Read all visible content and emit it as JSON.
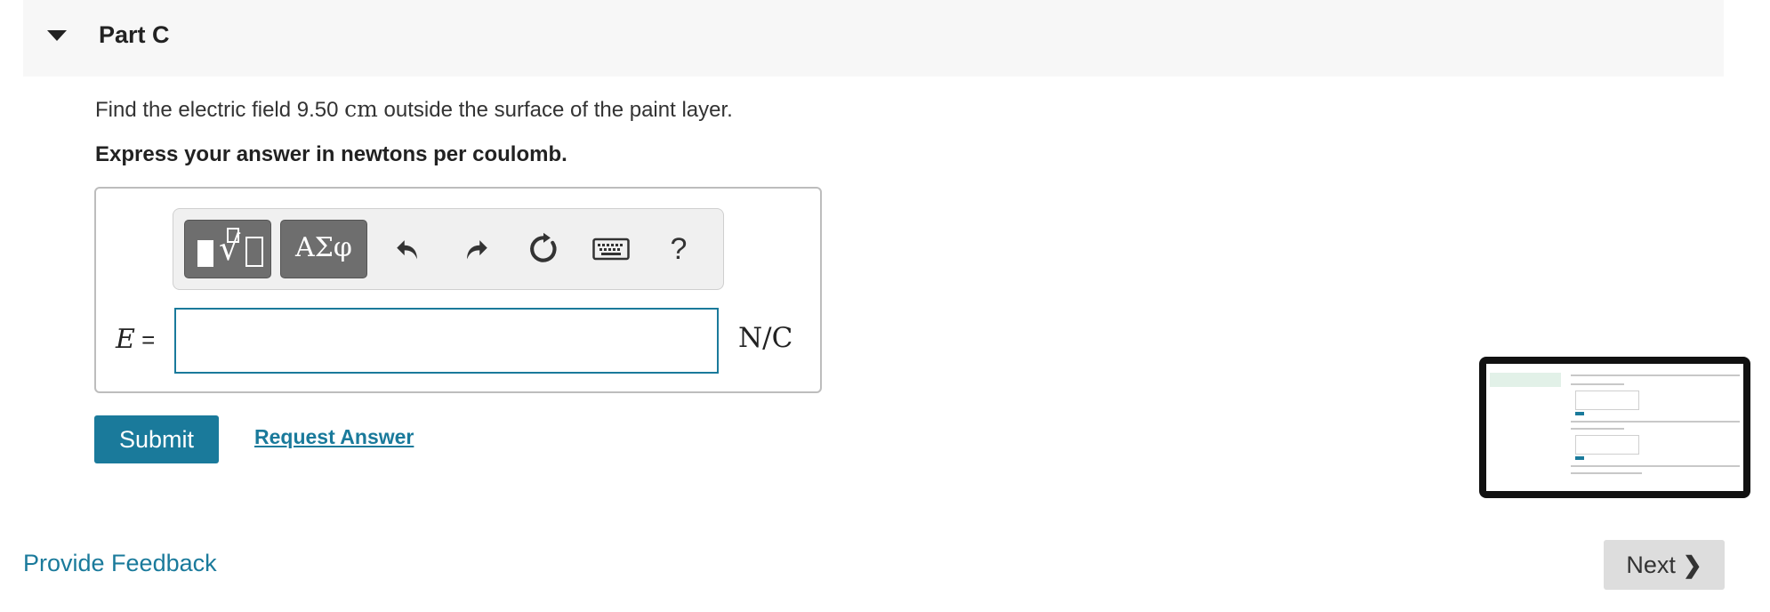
{
  "part": {
    "title": "Part C"
  },
  "question": {
    "text_before": "Find the electric field ",
    "value": "9.50",
    "unit": "cm",
    "text_after": " outside the surface of the paint layer."
  },
  "instruction": "Express your answer in newtons per coulomb.",
  "toolbar": {
    "greek_label": "ΑΣφ",
    "help_label": "?"
  },
  "answer": {
    "variable": "E",
    "equals": " =",
    "input_value": "",
    "unit": "N/C"
  },
  "actions": {
    "submit_label": "Submit",
    "request_answer_label": "Request Answer"
  },
  "footer": {
    "feedback_label": "Provide Feedback",
    "next_label": "Next"
  },
  "colors": {
    "accent": "#1a7a9b",
    "header_bg": "#f7f7f7",
    "next_bg": "#dddddd"
  }
}
